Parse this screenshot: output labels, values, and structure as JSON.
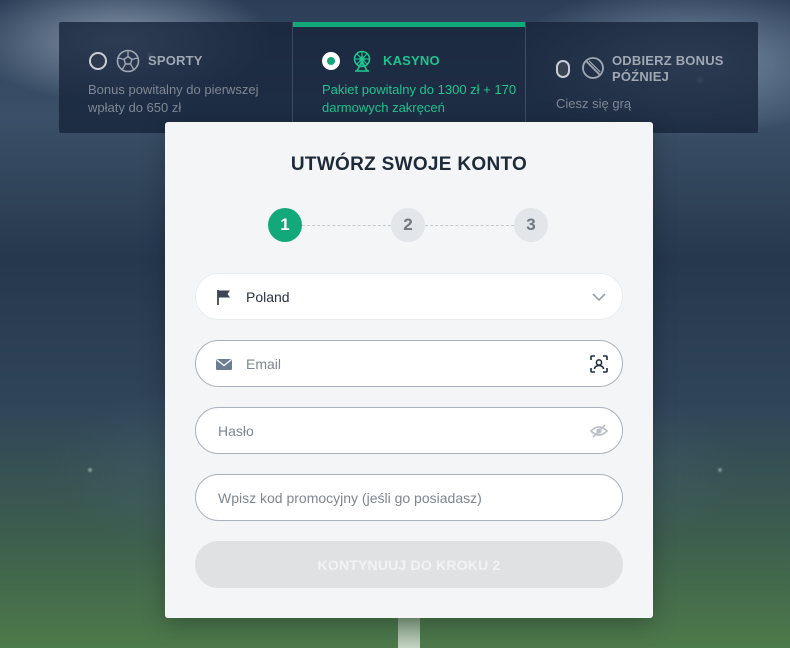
{
  "bonus": {
    "options": [
      {
        "title": "SPORTY",
        "description": "Bonus powitalny do pierwszej wpłaty do 650 zł",
        "selected": false,
        "icon": "soccer-ball-icon"
      },
      {
        "title": "KASYNO",
        "description": "Pakiet powitalny do 1300 zł + 170 darmowych zakręceń",
        "selected": true,
        "icon": "ferris-wheel-icon"
      },
      {
        "title": "ODBIERZ BONUS PÓŹNIEJ",
        "description": "Ciesz się grą",
        "selected": false,
        "icon": "no-bonus-icon"
      }
    ],
    "accent_color": "#12a87a"
  },
  "form": {
    "title": "UTWÓRZ SWOJE KONTO",
    "steps": [
      "1",
      "2",
      "3"
    ],
    "current_step": 1,
    "country": {
      "value": "Poland",
      "icon": "flag-icon"
    },
    "email": {
      "placeholder": "Email",
      "icon": "envelope-icon",
      "action_icon": "scan-face-icon"
    },
    "password": {
      "placeholder": "Hasło",
      "action_icon": "eye-slash-icon"
    },
    "promo": {
      "placeholder": "Wpisz kod promocyjny (jeśli go posiadasz)"
    },
    "submit_label": "KONTYNUUJ DO KROKU 2"
  }
}
